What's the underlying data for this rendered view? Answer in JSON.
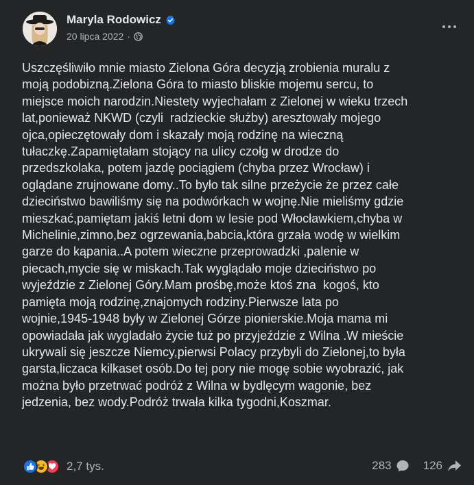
{
  "post": {
    "author": "Maryla Rodowicz",
    "date": "20 lipca 2022",
    "separator": "·",
    "text_lines": [
      "Uszczęśliwiło mnie miasto Zielona Góra decyzją zrobienia muralu z",
      "moją podobizną.Zielona Góra to miasto bliskie mojemu sercu, to",
      "miejsce moich narodzin.Niestety wyjechałam z Zielonej w wieku trzech",
      "lat,ponieważ NKWD (czyli  radzieckie służby) aresztowały mojego",
      "ojca,opieczętowały dom i skazały moją rodzinę na wieczną",
      "tułaczkę.Zapamiętałam stojący na ulicy czołg w drodze do",
      "przedszkolaka, potem jazdę pociągiem (chyba przez Wrocław) i",
      "oglądane zrujnowane domy..To było tak silne przeżycie że przez całe",
      "dzieciństwo bawiliśmy się na podwórkach w wojnę.Nie mieliśmy gdzie",
      "mieszkać,pamiętam jakiś letni dom w lesie pod Włocławkiem,chyba w",
      "Michelinie,zimno,bez ogrzewania,babcia,która grzała wodę w wielkim",
      "garze do kąpania..A potem wieczne przeprowadzki ,palenie w",
      "piecach,mycie się w miskach.Tak wyglądało moje dzieciństwo po",
      "wyjeździe z Zielonej Góry.Mam prośbę,może ktoś zna  kogoś, kto",
      "pamięta moją rodzinę,znajomych rodziny.Pierwsze lata po",
      "wojnie,1945-1948 były w Zielonej Górze pionierskie.Moja mama mi",
      "opowiadała jak wygladało życie tuż po przyjeździe z Wilna .W mieście",
      "ukrywali się jeszcze Niemcy,pierwsi Polacy przybyli do Zielonej,to była",
      "garsta,liczaca kilkaset osób.Do tej pory nie mogę sobie wyobrazić, jak",
      "można było przetrwać podróż z Wilna w bydlęcym wagonie, bez",
      "jedzenia, bez wody.Podróż trwała kilka tygodni,Koszmar."
    ]
  },
  "footer": {
    "reaction_count": "2,7 tys.",
    "comments_count": "283",
    "shares_count": "126"
  },
  "icons": {
    "verified": "verified-badge-icon",
    "globe": "globe-icon",
    "more": "more-options-icon",
    "like": "like-reaction-icon",
    "haha": "haha-reaction-icon",
    "love": "love-reaction-icon",
    "comment": "comment-icon",
    "share": "share-icon"
  },
  "colors": {
    "background": "#242526",
    "text_primary": "#e4e6eb",
    "text_secondary": "#b0b3b8",
    "verified": "#1b74e4",
    "like": "#1b74e4",
    "haha": "#f7b928",
    "love": "#f33e58"
  }
}
